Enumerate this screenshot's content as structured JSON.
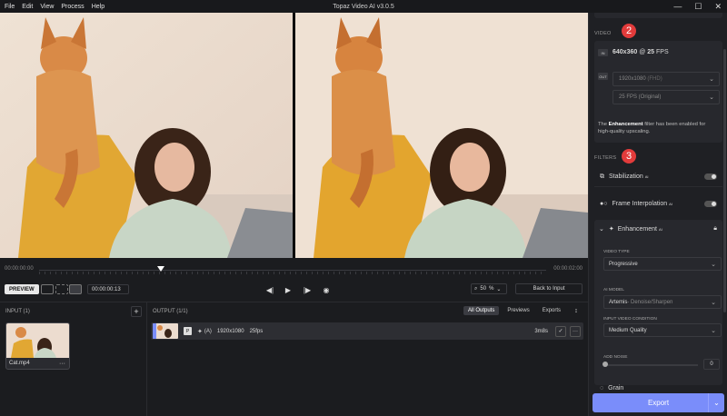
{
  "window": {
    "title": "Topaz Video AI  v3.0.5",
    "menu": [
      "File",
      "Edit",
      "View",
      "Process",
      "Help"
    ],
    "controls": [
      "—",
      "☐",
      "✕"
    ]
  },
  "timeline": {
    "start": "00:00:00:00",
    "end": "00:00:02:00",
    "progress": 0.24
  },
  "controls": {
    "preview_label": "PREVIEW",
    "timecode": "00:00:00:13",
    "zoom_value": "50",
    "zoom_unit": "%",
    "back_to_input": "Back to Input"
  },
  "input_panel": {
    "header": "INPUT (1)",
    "add": "+",
    "file": {
      "name": "Cat.mp4",
      "more": "···"
    }
  },
  "output_panel": {
    "header": "OUTPUT (1/1)",
    "tabs": [
      "All Outputs",
      "Previews",
      "Exports"
    ],
    "sort": "↕",
    "row": {
      "badge": "P",
      "mode": "(A)",
      "resolution": "1920x1080",
      "fps": "25fps",
      "duration": "3m8s",
      "check": "✓",
      "more": "···"
    }
  },
  "sidebar": {
    "video_label": "VIDEO",
    "callout_video": "2",
    "in_tag": "IN",
    "input_res": "640x360",
    "input_at": "@",
    "input_fps": "25",
    "input_fps_unit": "FPS",
    "out_tag": "OUT",
    "output_res": "1920x1080",
    "output_res_note": "(FHD)",
    "output_fps": "25 FPS (Original)",
    "note_pre": "The ",
    "note_bold": "Enhancement",
    "note_post": " filter has been enabled for high-quality upscaling.",
    "filters_label": "FILTERS",
    "callout_filters": "3",
    "filters": [
      {
        "name": "Stabilization",
        "sup": "AI",
        "enabled": false
      },
      {
        "name": "Frame Interpolation",
        "sup": "AI",
        "enabled": false
      }
    ],
    "enhancement": {
      "name": "Enhancement",
      "sup": "AI",
      "video_type_label": "VIDEO TYPE",
      "video_type": "Progressive",
      "model_label": "AI MODEL",
      "model": "Artemis",
      "model_suffix": " - Denoise/Sharpen",
      "condition_label": "INPUT VIDEO CONDITION",
      "condition": "Medium Quality",
      "noise_label": "ADD NOISE",
      "noise_value": "0"
    },
    "next_filter": "Grain",
    "export": "Export",
    "export_arrow": "⌄"
  },
  "colors": {
    "accent": "#7a8dfa",
    "callout": "#e23b3b",
    "bg": "#1b1c1f"
  }
}
